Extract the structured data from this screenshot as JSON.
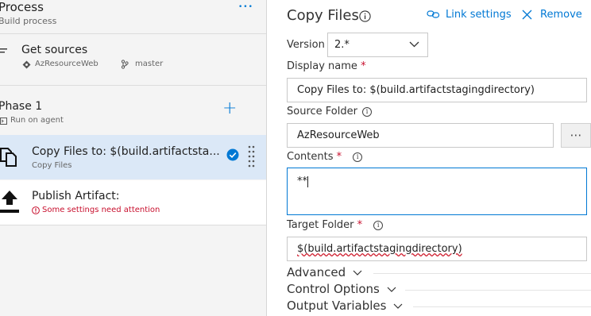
{
  "left": {
    "process": {
      "title": "Process",
      "subtitle": "Build process",
      "more_label": "•••"
    },
    "sources": {
      "title": "Get sources",
      "repo": "AzResourceWeb",
      "branch": "master"
    },
    "phase": {
      "title": "Phase 1",
      "subtitle": "Run on agent",
      "add_label": "+"
    },
    "tasks": [
      {
        "title": "Copy Files to: $(build.artifactsta...",
        "subtitle": "Copy Files"
      },
      {
        "title": "Publish Artifact:",
        "subtitle": "Some settings need attention"
      }
    ]
  },
  "panel": {
    "title": "Copy Files",
    "link_settings": "Link settings",
    "remove": "Remove",
    "version_label": "Version",
    "version_value": "2.*",
    "display_name_label": "Display name",
    "display_name_value": "Copy Files to: $(build.artifactstagingdirectory)",
    "source_folder_label": "Source Folder",
    "source_folder_value": "AzResourceWeb",
    "browse_label": "⋯",
    "contents_label": "Contents",
    "contents_value": "**",
    "target_folder_label": "Target Folder",
    "target_folder_value": "$(build.artifactstagingdirectory)",
    "required_mark": "*",
    "sections": [
      "Advanced",
      "Control Options",
      "Output Variables"
    ]
  },
  "colors": {
    "accent": "#0078d4",
    "selected_row": "#dbe8f7",
    "error": "#c8102e"
  }
}
